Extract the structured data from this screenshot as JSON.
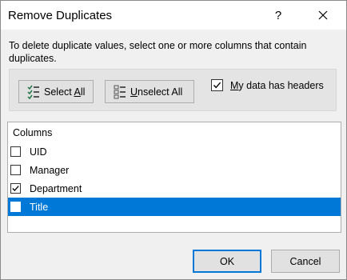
{
  "dialog": {
    "title": "Remove Duplicates",
    "help_label": "?",
    "close_icon": "close-icon"
  },
  "description": "To delete duplicate values, select one or more columns that contain duplicates.",
  "buttons": {
    "select_all": {
      "pre": "Select ",
      "key": "A",
      "post": "ll"
    },
    "unselect_all": {
      "pre": "",
      "key": "U",
      "post": "nselect All"
    },
    "ok": "OK",
    "cancel": "Cancel"
  },
  "headers_checkbox": {
    "pre": "",
    "key": "M",
    "post": "y data has headers",
    "checked": true
  },
  "columns_list": {
    "header": "Columns",
    "items": [
      {
        "label": "UID",
        "checked": false,
        "selected": false
      },
      {
        "label": "Manager",
        "checked": false,
        "selected": false
      },
      {
        "label": "Department",
        "checked": true,
        "selected": false
      },
      {
        "label": "Title",
        "checked": false,
        "selected": true
      }
    ]
  },
  "colors": {
    "selection": "#0078d7",
    "dialog_bg": "#f0f0f0",
    "accent_border": "#0078d7"
  }
}
